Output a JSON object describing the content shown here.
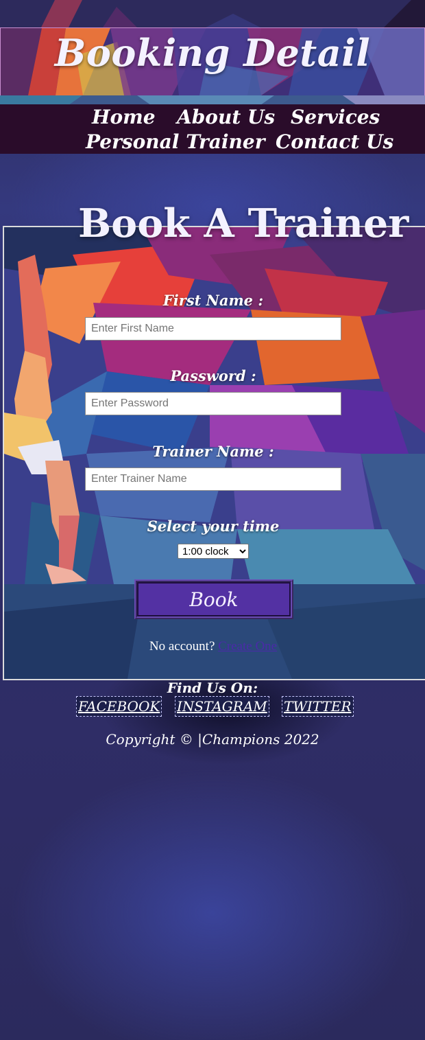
{
  "header": {
    "title": "Booking Detail"
  },
  "nav": {
    "items": [
      {
        "label": "Home"
      },
      {
        "label": "About Us"
      },
      {
        "label": "Services"
      },
      {
        "label": "Personal Trainer"
      },
      {
        "label": "Contact Us"
      }
    ]
  },
  "form": {
    "title": "Book A Trainer",
    "first_name_label": "First Name :",
    "first_name_placeholder": "Enter First Name",
    "password_label": "Password :",
    "password_placeholder": "Enter Password",
    "trainer_label": "Trainer Name :",
    "trainer_placeholder": "Enter Trainer Name",
    "time_label": "Select your time",
    "time_selected": "1:00 clock",
    "book_label": "Book",
    "no_account_text": "No account?",
    "create_link": "Create One"
  },
  "footer": {
    "find_us": "Find Us On:",
    "social": [
      {
        "label": "FACEBOOK"
      },
      {
        "label": "INSTAGRAM"
      },
      {
        "label": "TWITTER"
      }
    ],
    "copyright": "Copyright © |Champions 2022"
  },
  "colors": {
    "nav_bg": "#2a0c2a",
    "button_bg": "#5331a3",
    "page_bg": "#2e2d66"
  }
}
